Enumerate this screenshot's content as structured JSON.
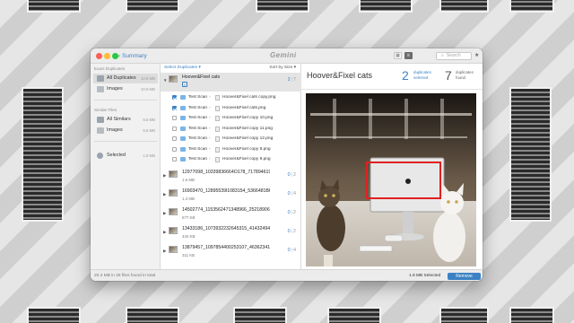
{
  "toolbar": {
    "back_label": "Summary",
    "logo_text": "Gemini",
    "search_placeholder": "Search"
  },
  "sidebar": {
    "exact_header": "Exact Duplicates",
    "exact_items": [
      {
        "label": "All Duplicates",
        "size": "10.9 MB",
        "icon": "stack-icon"
      },
      {
        "label": "Images",
        "size": "10.9 MB",
        "icon": "image-icon"
      }
    ],
    "similar_header": "Similar Files",
    "similar_items": [
      {
        "label": "All Similars",
        "size": "9.6 MB",
        "icon": "stack-icon"
      },
      {
        "label": "Images",
        "size": "9.6 MB",
        "icon": "image-icon"
      }
    ],
    "selected_item": {
      "label": "Selected",
      "size": "1.8 MB",
      "icon": "selected-icon"
    }
  },
  "list": {
    "header_left": "Select Duplicates ▾",
    "header_right": "Sort by Size ▾",
    "selected_group": {
      "name": "Hoover&Fixel cats",
      "selected": "2",
      "total": "7"
    },
    "files": [
      {
        "checked": true,
        "folder": "Test Scan",
        "name": "Hoover&Fixel cats copy.png"
      },
      {
        "checked": true,
        "folder": "Test Scan",
        "name": "Hoover&Fixel cats.png"
      },
      {
        "checked": false,
        "folder": "Test Scan",
        "name": "Hoover&Fixel copy 10.png"
      },
      {
        "checked": false,
        "folder": "Test Scan",
        "name": "Hoover&Fixel copy 11.png"
      },
      {
        "checked": false,
        "folder": "Test Scan",
        "name": "Hoover&Fixel copy 12.png"
      },
      {
        "checked": false,
        "folder": "Test Scan",
        "name": "Hoover&Fixel copy 8.png"
      },
      {
        "checked": false,
        "folder": "Test Scan",
        "name": "Hoover&Fixel copy 9.png"
      }
    ],
    "groups": [
      {
        "name": "12977098_10339836664O178_7178946194...",
        "size": "1.6 MB",
        "selected": "0",
        "total": "2"
      },
      {
        "name": "16903470_12895539l1083154_5366481B6...",
        "size": "1.3 MB",
        "selected": "0",
        "total": "4"
      },
      {
        "name": "14502774_1153562471348966_2521890611...",
        "size": "677 KB",
        "selected": "0",
        "total": "2"
      },
      {
        "name": "13433186_1073932232645315_414324942...",
        "size": "434 KB",
        "selected": "0",
        "total": "2"
      },
      {
        "name": "13879457_1097854400253107_463623410...",
        "size": "311 KB",
        "selected": "0",
        "total": "4"
      }
    ]
  },
  "detail": {
    "title": "Hoover&Fixel cats",
    "selected_count": "2",
    "selected_label_line1": "duplicates",
    "selected_label_line2": "selected",
    "found_count": "7",
    "found_label_line1": "duplicates",
    "found_label_line2": "found"
  },
  "footer": {
    "info": "20.4 MB in 26 files found in total",
    "selected": "1.8 MB Selected",
    "remove_label": "Remove"
  },
  "colors": {
    "accent": "#3b82c4",
    "highlight_box": "#e02020"
  }
}
